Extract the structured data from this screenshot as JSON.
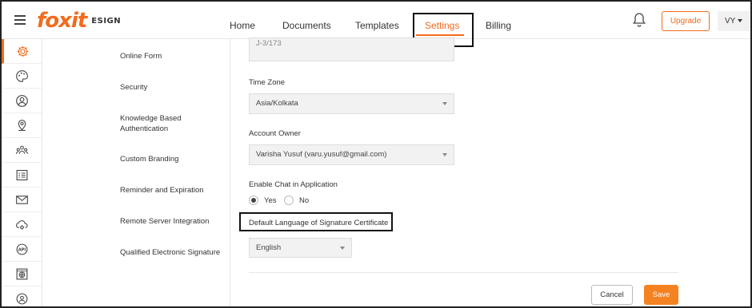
{
  "header": {
    "logo_text": "foxit",
    "logo_sub": "ESIGN",
    "nav": [
      {
        "label": "Home"
      },
      {
        "label": "Documents"
      },
      {
        "label": "Templates"
      },
      {
        "label": "Settings"
      },
      {
        "label": "Billing"
      }
    ],
    "active_nav": "Settings",
    "upgrade_label": "Upgrade",
    "user_initials": "VY"
  },
  "rail": {
    "icons": [
      "gear-icon",
      "palette-icon",
      "user-circle-icon",
      "location-pin-icon",
      "group-icon",
      "form-list-icon",
      "envelope-icon",
      "cloud-gear-icon",
      "api-icon",
      "globe-window-icon",
      "user-badge-icon"
    ],
    "active_index": 0
  },
  "submenu": {
    "items": [
      {
        "label": "Online Form"
      },
      {
        "label": "Security"
      },
      {
        "label": "Knowledge Based Authentication"
      },
      {
        "label": "Custom Branding"
      },
      {
        "label": "Reminder and Expiration"
      },
      {
        "label": "Remote Server Integration"
      },
      {
        "label": "Qualified Electronic Signature"
      }
    ]
  },
  "form": {
    "address_value": "J-3/173",
    "timezone": {
      "label": "Time Zone",
      "value": "Asia/Kolkata"
    },
    "account_owner": {
      "label": "Account Owner",
      "value": "Varisha Yusuf (varu.yusuf@gmail.com)"
    },
    "chat": {
      "label": "Enable Chat in Application",
      "options": [
        "Yes",
        "No"
      ],
      "selected": "Yes"
    },
    "language": {
      "label": "Default Language of Signature Certificate",
      "value": "English"
    },
    "cancel_label": "Cancel",
    "save_label": "Save"
  },
  "colors": {
    "accent": "#f26b1d",
    "save_button": "#f58220"
  }
}
